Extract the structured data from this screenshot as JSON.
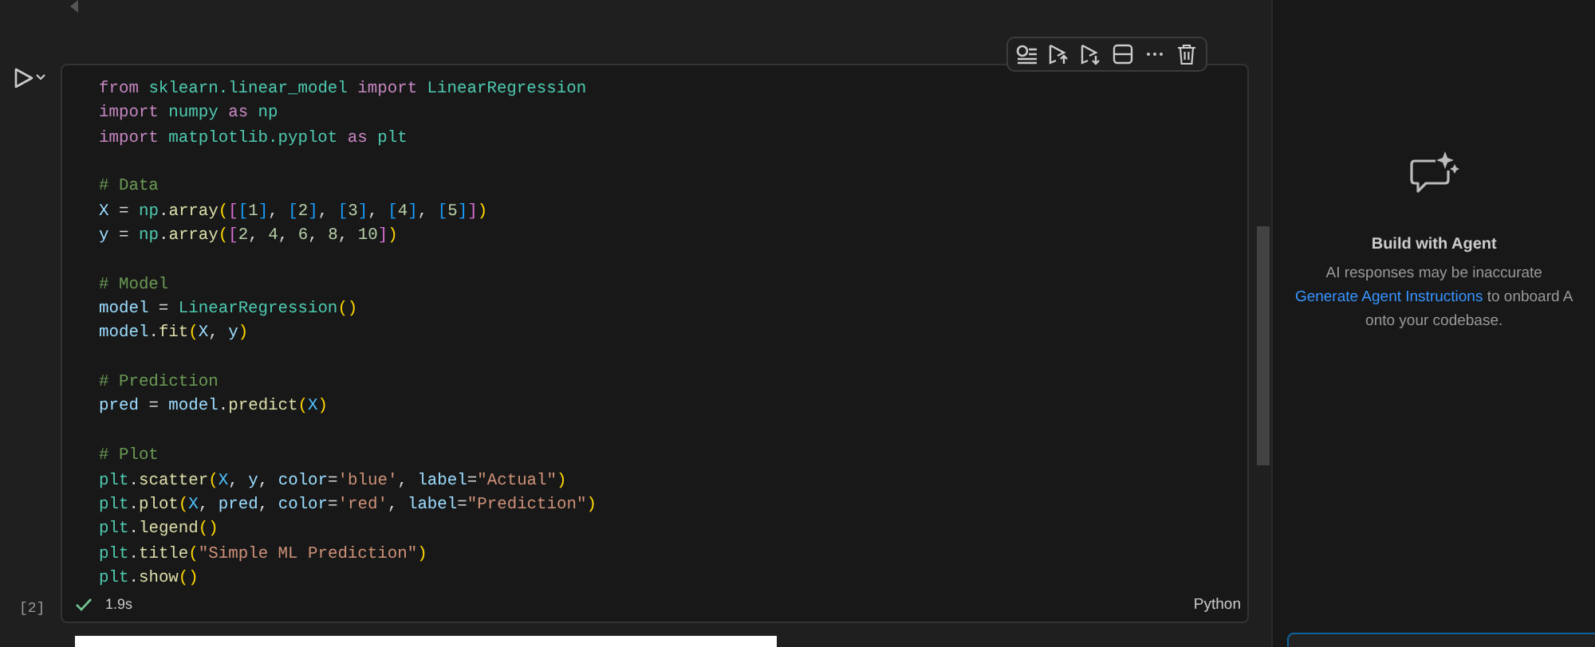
{
  "cell": {
    "code": [
      {
        "kind": "code",
        "tokens": [
          {
            "text": "from ",
            "kind": "kw"
          },
          {
            "text": "sklearn.linear_model ",
            "kind": "cls"
          },
          {
            "text": "import ",
            "kind": "kw"
          },
          {
            "text": "LinearRegression",
            "kind": "cls"
          }
        ]
      },
      {
        "kind": "code",
        "tokens": [
          {
            "text": "import ",
            "kind": "kw"
          },
          {
            "text": "numpy ",
            "kind": "cls"
          },
          {
            "text": "as ",
            "kind": "kw"
          },
          {
            "text": "np",
            "kind": "cls"
          }
        ]
      },
      {
        "kind": "code",
        "tokens": [
          {
            "text": "import ",
            "kind": "kw"
          },
          {
            "text": "matplotlib.pyplot ",
            "kind": "cls"
          },
          {
            "text": "as ",
            "kind": "kw"
          },
          {
            "text": "plt",
            "kind": "cls"
          }
        ]
      },
      {
        "kind": "blank"
      },
      {
        "kind": "code",
        "tokens": [
          {
            "text": "# Data",
            "kind": "com"
          }
        ]
      },
      {
        "kind": "code",
        "tokens": [
          {
            "text": "X",
            "kind": "var"
          },
          {
            "text": " = ",
            "kind": "op"
          },
          {
            "text": "np",
            "kind": "cls"
          },
          {
            "text": ".",
            "kind": "op"
          },
          {
            "text": "array",
            "kind": "fn"
          },
          {
            "text": "(",
            "kind": "b1"
          },
          {
            "text": "[",
            "kind": "b2"
          },
          {
            "text": "[",
            "kind": "b3"
          },
          {
            "text": "1",
            "kind": "num"
          },
          {
            "text": "]",
            "kind": "b3"
          },
          {
            "text": ", ",
            "kind": "op"
          },
          {
            "text": "[",
            "kind": "b3"
          },
          {
            "text": "2",
            "kind": "num"
          },
          {
            "text": "]",
            "kind": "b3"
          },
          {
            "text": ", ",
            "kind": "op"
          },
          {
            "text": "[",
            "kind": "b3"
          },
          {
            "text": "3",
            "kind": "num"
          },
          {
            "text": "]",
            "kind": "b3"
          },
          {
            "text": ", ",
            "kind": "op"
          },
          {
            "text": "[",
            "kind": "b3"
          },
          {
            "text": "4",
            "kind": "num"
          },
          {
            "text": "]",
            "kind": "b3"
          },
          {
            "text": ", ",
            "kind": "op"
          },
          {
            "text": "[",
            "kind": "b3"
          },
          {
            "text": "5",
            "kind": "num"
          },
          {
            "text": "]",
            "kind": "b3"
          },
          {
            "text": "]",
            "kind": "b2"
          },
          {
            "text": ")",
            "kind": "b1"
          }
        ]
      },
      {
        "kind": "code",
        "tokens": [
          {
            "text": "y",
            "kind": "var"
          },
          {
            "text": " = ",
            "kind": "op"
          },
          {
            "text": "np",
            "kind": "cls"
          },
          {
            "text": ".",
            "kind": "op"
          },
          {
            "text": "array",
            "kind": "fn"
          },
          {
            "text": "(",
            "kind": "b1"
          },
          {
            "text": "[",
            "kind": "b2"
          },
          {
            "text": "2",
            "kind": "num"
          },
          {
            "text": ", ",
            "kind": "op"
          },
          {
            "text": "4",
            "kind": "num"
          },
          {
            "text": ", ",
            "kind": "op"
          },
          {
            "text": "6",
            "kind": "num"
          },
          {
            "text": ", ",
            "kind": "op"
          },
          {
            "text": "8",
            "kind": "num"
          },
          {
            "text": ", ",
            "kind": "op"
          },
          {
            "text": "10",
            "kind": "num"
          },
          {
            "text": "]",
            "kind": "b2"
          },
          {
            "text": ")",
            "kind": "b1"
          }
        ]
      },
      {
        "kind": "blank"
      },
      {
        "kind": "code",
        "tokens": [
          {
            "text": "# Model",
            "kind": "com"
          }
        ]
      },
      {
        "kind": "code",
        "tokens": [
          {
            "text": "model",
            "kind": "var"
          },
          {
            "text": " = ",
            "kind": "op"
          },
          {
            "text": "LinearRegression",
            "kind": "cls"
          },
          {
            "text": "()",
            "kind": "b1"
          }
        ]
      },
      {
        "kind": "code",
        "tokens": [
          {
            "text": "model",
            "kind": "var"
          },
          {
            "text": ".",
            "kind": "op"
          },
          {
            "text": "fit",
            "kind": "fn"
          },
          {
            "text": "(",
            "kind": "b1"
          },
          {
            "text": "X",
            "kind": "var"
          },
          {
            "text": ", ",
            "kind": "op"
          },
          {
            "text": "y",
            "kind": "var"
          },
          {
            "text": ")",
            "kind": "b1"
          }
        ]
      },
      {
        "kind": "blank"
      },
      {
        "kind": "code",
        "tokens": [
          {
            "text": "# Prediction",
            "kind": "com"
          }
        ]
      },
      {
        "kind": "code",
        "tokens": [
          {
            "text": "pred",
            "kind": "var"
          },
          {
            "text": " = ",
            "kind": "op"
          },
          {
            "text": "model",
            "kind": "var"
          },
          {
            "text": ".",
            "kind": "op"
          },
          {
            "text": "predict",
            "kind": "fn"
          },
          {
            "text": "(",
            "kind": "b1"
          },
          {
            "text": "X",
            "kind": "var2"
          },
          {
            "text": ")",
            "kind": "b1"
          }
        ]
      },
      {
        "kind": "blank"
      },
      {
        "kind": "code",
        "tokens": [
          {
            "text": "# Plot",
            "kind": "com"
          }
        ]
      },
      {
        "kind": "code",
        "tokens": [
          {
            "text": "plt",
            "kind": "cls"
          },
          {
            "text": ".",
            "kind": "op"
          },
          {
            "text": "scatter",
            "kind": "fn"
          },
          {
            "text": "(",
            "kind": "b1"
          },
          {
            "text": "X",
            "kind": "var2"
          },
          {
            "text": ", ",
            "kind": "op"
          },
          {
            "text": "y",
            "kind": "var"
          },
          {
            "text": ", ",
            "kind": "op"
          },
          {
            "text": "color",
            "kind": "var"
          },
          {
            "text": "=",
            "kind": "op"
          },
          {
            "text": "'blue'",
            "kind": "str"
          },
          {
            "text": ", ",
            "kind": "op"
          },
          {
            "text": "label",
            "kind": "var"
          },
          {
            "text": "=",
            "kind": "op"
          },
          {
            "text": "\"Actual\"",
            "kind": "str"
          },
          {
            "text": ")",
            "kind": "b1"
          }
        ]
      },
      {
        "kind": "code",
        "tokens": [
          {
            "text": "plt",
            "kind": "cls"
          },
          {
            "text": ".",
            "kind": "op"
          },
          {
            "text": "plot",
            "kind": "fn"
          },
          {
            "text": "(",
            "kind": "b1"
          },
          {
            "text": "X",
            "kind": "var2"
          },
          {
            "text": ", ",
            "kind": "op"
          },
          {
            "text": "pred",
            "kind": "var"
          },
          {
            "text": ", ",
            "kind": "op"
          },
          {
            "text": "color",
            "kind": "var"
          },
          {
            "text": "=",
            "kind": "op"
          },
          {
            "text": "'red'",
            "kind": "str"
          },
          {
            "text": ", ",
            "kind": "op"
          },
          {
            "text": "label",
            "kind": "var"
          },
          {
            "text": "=",
            "kind": "op"
          },
          {
            "text": "\"Prediction\"",
            "kind": "str"
          },
          {
            "text": ")",
            "kind": "b1"
          }
        ]
      },
      {
        "kind": "code",
        "tokens": [
          {
            "text": "plt",
            "kind": "cls"
          },
          {
            "text": ".",
            "kind": "op"
          },
          {
            "text": "legend",
            "kind": "fn"
          },
          {
            "text": "()",
            "kind": "b1"
          }
        ]
      },
      {
        "kind": "code",
        "tokens": [
          {
            "text": "plt",
            "kind": "cls"
          },
          {
            "text": ".",
            "kind": "op"
          },
          {
            "text": "title",
            "kind": "fn"
          },
          {
            "text": "(",
            "kind": "b1"
          },
          {
            "text": "\"Simple ML Prediction\"",
            "kind": "str"
          },
          {
            "text": ")",
            "kind": "b1"
          }
        ]
      },
      {
        "kind": "code",
        "tokens": [
          {
            "text": "plt",
            "kind": "cls"
          },
          {
            "text": ".",
            "kind": "op"
          },
          {
            "text": "show",
            "kind": "fn"
          },
          {
            "text": "()",
            "kind": "b1"
          }
        ]
      }
    ],
    "execution_count": "[2]",
    "succeeded": true,
    "duration": "1.9s",
    "language": "Python"
  },
  "agent_panel": {
    "title": "Build with Agent",
    "note": "AI responses may be inaccurate",
    "link": "Generate Agent Instructions",
    "text_after_link": " to onboard A",
    "text_line_2": "onto your codebase."
  }
}
